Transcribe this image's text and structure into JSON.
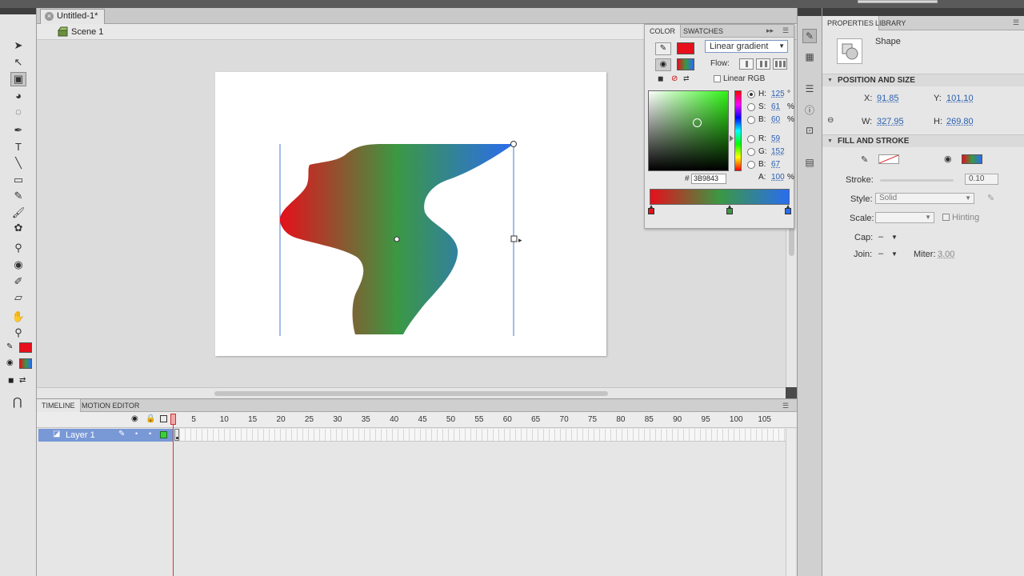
{
  "document": {
    "tab_title": "Untitled-1*",
    "close_glyph": "×"
  },
  "editbar": {
    "scene_label": "Scene 1"
  },
  "tools": [
    {
      "name": "selection-tool-icon",
      "glyph": "➤"
    },
    {
      "name": "subselection-tool-icon",
      "glyph": "↖"
    },
    {
      "name": "free-transform-tool-icon",
      "glyph": "▣"
    },
    {
      "name": "3d-rotation-tool-icon",
      "glyph": "◕"
    },
    {
      "name": "lasso-tool-icon",
      "glyph": "◌"
    },
    {
      "name": "pen-tool-icon",
      "glyph": "✒"
    },
    {
      "name": "text-tool-icon",
      "glyph": "T"
    },
    {
      "name": "line-tool-icon",
      "glyph": "╲"
    },
    {
      "name": "rectangle-tool-icon",
      "glyph": "▭"
    },
    {
      "name": "pencil-tool-icon",
      "glyph": "✎"
    },
    {
      "name": "brush-tool-icon",
      "glyph": "🖌"
    },
    {
      "name": "deco-tool-icon",
      "glyph": "✿"
    },
    {
      "name": "bone-tool-icon",
      "glyph": "⚲"
    },
    {
      "name": "paint-bucket-tool-icon",
      "glyph": "◉"
    },
    {
      "name": "eyedropper-tool-icon",
      "glyph": "✐"
    },
    {
      "name": "eraser-tool-icon",
      "glyph": "▱"
    },
    {
      "name": "hand-tool-icon",
      "glyph": "✋"
    },
    {
      "name": "zoom-tool-icon",
      "glyph": "⚲"
    }
  ],
  "colors": {
    "stroke": "#e60f1b",
    "gradient_start": "#e60f1b",
    "gradient_mid": "#3b9843",
    "gradient_end": "#2a6cf0"
  },
  "color_panel": {
    "tab_color": "COLOR",
    "tab_swatches": "SWATCHES",
    "type_value": "Linear gradient",
    "flow_label": "Flow:",
    "linear_rgb_label": "Linear RGB",
    "hsb": [
      {
        "key": "H:",
        "value": "125",
        "unit": "°",
        "selected": true
      },
      {
        "key": "S:",
        "value": "61",
        "unit": "%",
        "selected": false
      },
      {
        "key": "B:",
        "value": "60",
        "unit": "%",
        "selected": false
      }
    ],
    "rgb": [
      {
        "key": "R:",
        "value": "59",
        "unit": "",
        "selected": false
      },
      {
        "key": "G:",
        "value": "152",
        "unit": "",
        "selected": false
      },
      {
        "key": "B:",
        "value": "67",
        "unit": "",
        "selected": false
      }
    ],
    "alpha": {
      "key": "A:",
      "value": "100",
      "unit": "%"
    },
    "hex_prefix": "#",
    "hex_value": "3B9843"
  },
  "properties": {
    "tab_properties": "PROPERTIES",
    "tab_library": "LIBRARY",
    "instance_type": "Shape",
    "position_size_header": "POSITION AND SIZE",
    "x_label": "X:",
    "x_value": "91.85",
    "y_label": "Y:",
    "y_value": "101.10",
    "w_label": "W:",
    "w_value": "327.95",
    "h_label": "H:",
    "h_value": "269.80",
    "fill_stroke_header": "FILL AND STROKE",
    "stroke_label": "Stroke:",
    "stroke_value": "0.10",
    "style_label": "Style:",
    "style_value": "Solid",
    "scale_label": "Scale:",
    "hinting_label": "Hinting",
    "cap_label": "Cap:",
    "cap_value": "–",
    "join_label": "Join:",
    "join_value": "–",
    "miter_label": "Miter:",
    "miter_value": "3.00"
  },
  "timeline": {
    "tab_timeline": "TIMELINE",
    "tab_motion_editor": "MOTION EDITOR",
    "frame_numbers": [
      "1",
      "5",
      "10",
      "15",
      "20",
      "25",
      "30",
      "35",
      "40",
      "45",
      "50",
      "55",
      "60",
      "65",
      "70",
      "75",
      "80",
      "85",
      "90",
      "95",
      "100",
      "105"
    ],
    "layer_name": "Layer 1"
  }
}
